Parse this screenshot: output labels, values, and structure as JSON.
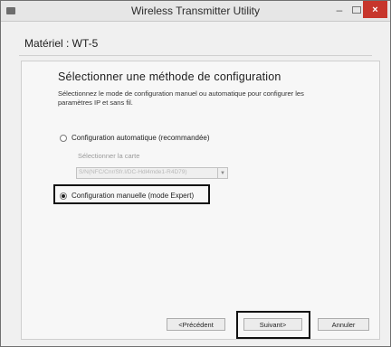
{
  "window": {
    "title": "Wireless Transmitter Utility",
    "minimize_glyph": "–",
    "close_glyph": "×"
  },
  "device": {
    "label": "Matériel : WT-5"
  },
  "main": {
    "heading": "Sélectionner une méthode de configuration",
    "description": "Sélectionnez le mode de configuration manuel ou automatique pour configurer les paramètres IP et sans fil.",
    "options": [
      {
        "label": "Configuration automatique (recommandée)",
        "selected": false
      },
      {
        "label": "Configuration manuelle (mode Expert)",
        "selected": true
      }
    ],
    "card_select": {
      "label": "Sélectionner la carte",
      "value": "S/N(NFC/Cnr/Sfr.I/DC-Hdl4mde1-R4D79)",
      "disabled": true
    }
  },
  "footer": {
    "prev_label": "<Précédent",
    "next_label": "Suivant>",
    "cancel_label": "Annuler"
  },
  "icons": {
    "app": "app-icon",
    "minimize": "minimize-icon",
    "maximize": "maximize-icon",
    "close": "close-icon",
    "dropdown": "chevron-down-icon"
  },
  "colors": {
    "close_button": "#c7362c",
    "highlight_border": "#111111"
  }
}
